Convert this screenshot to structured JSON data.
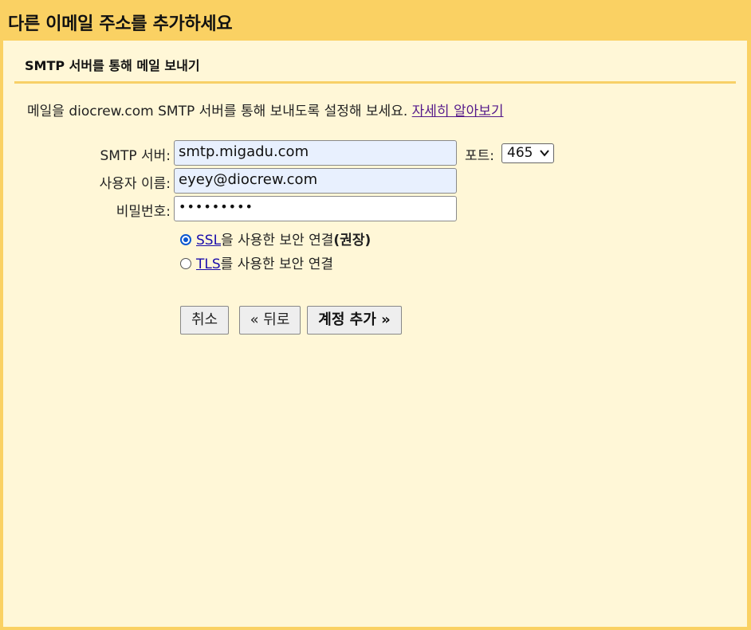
{
  "dialog": {
    "title": "다른 이메일 주소를 추가하세요"
  },
  "section": {
    "title": "SMTP 서버를 통해 메일 보내기"
  },
  "intro": {
    "text": "메일을 diocrew.com SMTP 서버를 통해 보내도록 설정해 보세요. ",
    "link": "자세히 알아보기"
  },
  "form": {
    "smtp_label": "SMTP 서버:",
    "smtp_value": "smtp.migadu.com",
    "port_label": "포트:",
    "port_value": "465",
    "username_label": "사용자 이름:",
    "username_value": "eyey@diocrew.com",
    "password_label": "비밀번호:",
    "password_value": "•••••••••",
    "ssl_link": "SSL",
    "ssl_text": "을 사용한 보안 연결",
    "ssl_recommended": "(권장)",
    "ssl_selected": true,
    "tls_link": "TLS",
    "tls_text": "를 사용한 보안 연결",
    "tls_selected": false
  },
  "buttons": {
    "cancel": "취소",
    "back": "« 뒤로",
    "add_account": "계정 추가 »"
  }
}
